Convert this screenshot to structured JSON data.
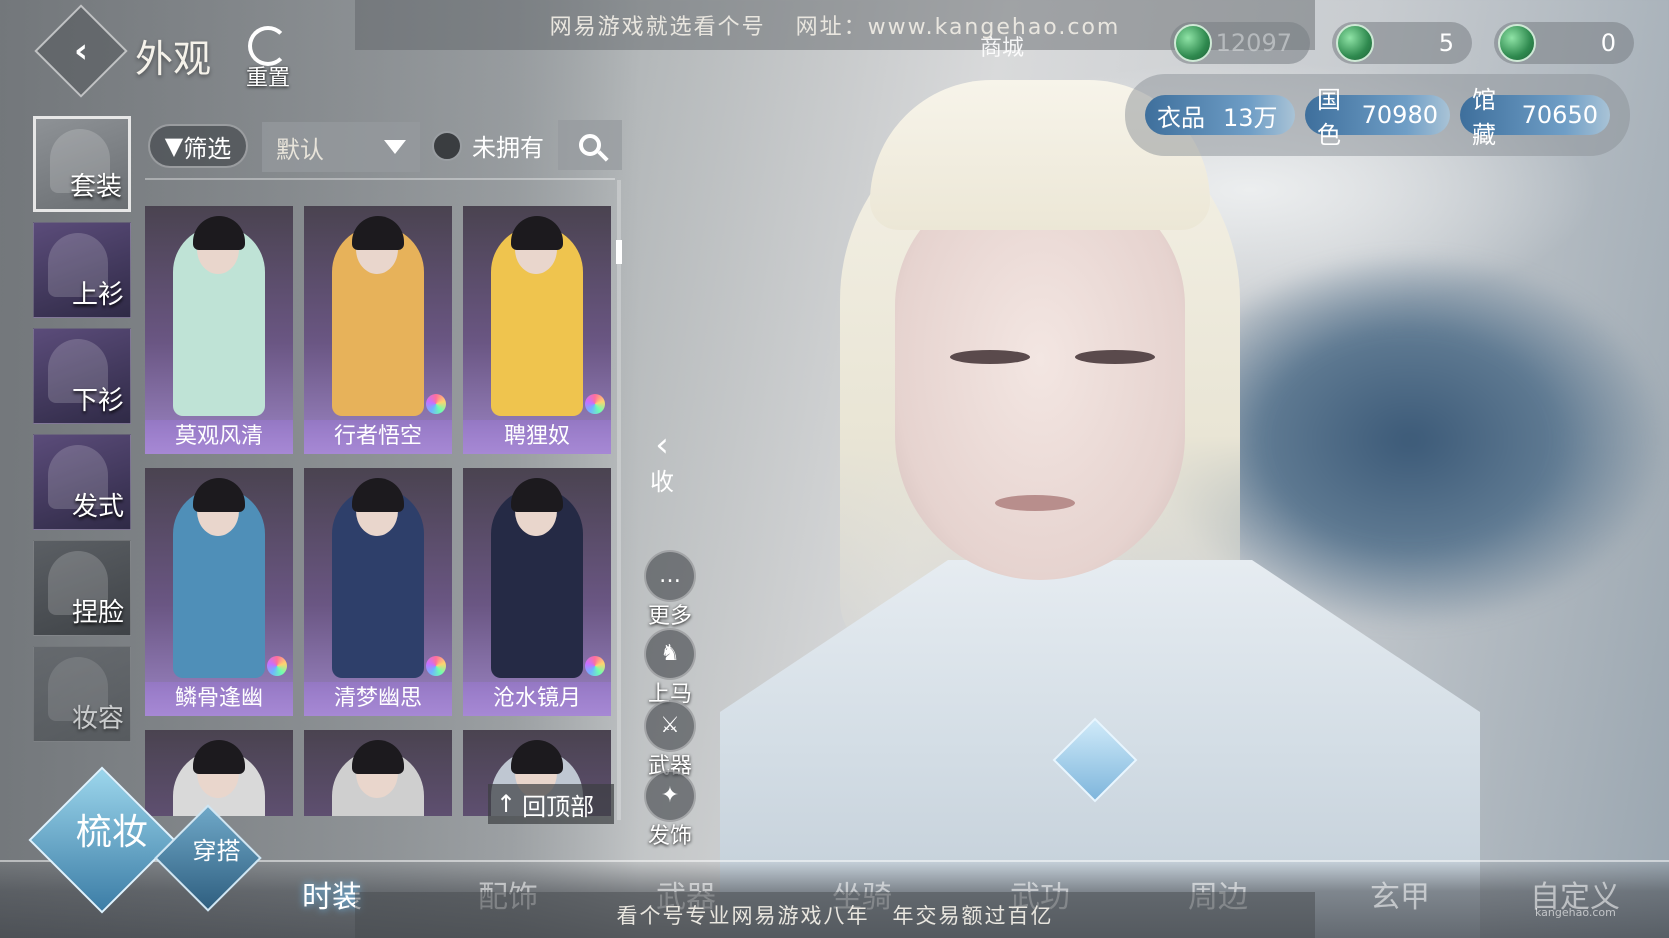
{
  "header": {
    "title": "外观",
    "reset_label": "重置",
    "shop_label": "商城"
  },
  "watermark": {
    "top_left": "网易游戏就选看个号",
    "top_right": "网址：www.kangehao.com",
    "bottom": "看个号专业网易游戏八年　年交易额过百亿",
    "brand": "kangehao.com"
  },
  "currencies": [
    {
      "icon": "jade-coin-icon",
      "value": "12097"
    },
    {
      "icon": "jade-coin-icon",
      "value": "5"
    },
    {
      "icon": "jade-coin-icon",
      "value": "0"
    }
  ],
  "stats": [
    {
      "label": "衣品",
      "value": "13万"
    },
    {
      "label": "国色",
      "value": "70980"
    },
    {
      "label": "馆藏",
      "value": "70650"
    }
  ],
  "side_tabs": [
    {
      "label": "套装",
      "icon": "robe-icon"
    },
    {
      "label": "上衫",
      "icon": "jacket-icon"
    },
    {
      "label": "下衫",
      "icon": "pants-icon"
    },
    {
      "label": "发式",
      "icon": "hairstyle-icon"
    },
    {
      "label": "捏脸",
      "icon": "face-mask-icon"
    },
    {
      "label": "妆容",
      "icon": "makeup-icon"
    }
  ],
  "filter": {
    "filter_label": "筛选",
    "sort_value": "默认",
    "unowned_label": "未拥有"
  },
  "items": [
    {
      "name": "莫观风清",
      "outfit": "#bfe3d6"
    },
    {
      "name": "行者悟空",
      "outfit": "#e7b25a"
    },
    {
      "name": "聘狸奴",
      "outfit": "#efc44e"
    },
    {
      "name": "鳞骨逢幽",
      "outfit": "#4f8fb8"
    },
    {
      "name": "清梦幽思",
      "outfit": "#2e3f6a"
    },
    {
      "name": "沧水镜月",
      "outfit": "#252a45"
    },
    {
      "name": "",
      "outfit": "#d9d9d9"
    },
    {
      "name": "",
      "outfit": "#cfcfcf"
    },
    {
      "name": "",
      "outfit": "#bfc7d2"
    }
  ],
  "back_to_top_label": "回顶部",
  "actions": {
    "collapse_label": "收",
    "more_label": "更多",
    "mount_label": "上马",
    "weapon_label": "武器",
    "hair_accessory_label": "发饰"
  },
  "bottom_nav": {
    "grooming_label": "梳妆",
    "outfit_label": "穿搭",
    "tabs": [
      "时装",
      "配饰",
      "武器",
      "坐骑",
      "武功",
      "周边",
      "玄甲",
      "自定义"
    ]
  }
}
